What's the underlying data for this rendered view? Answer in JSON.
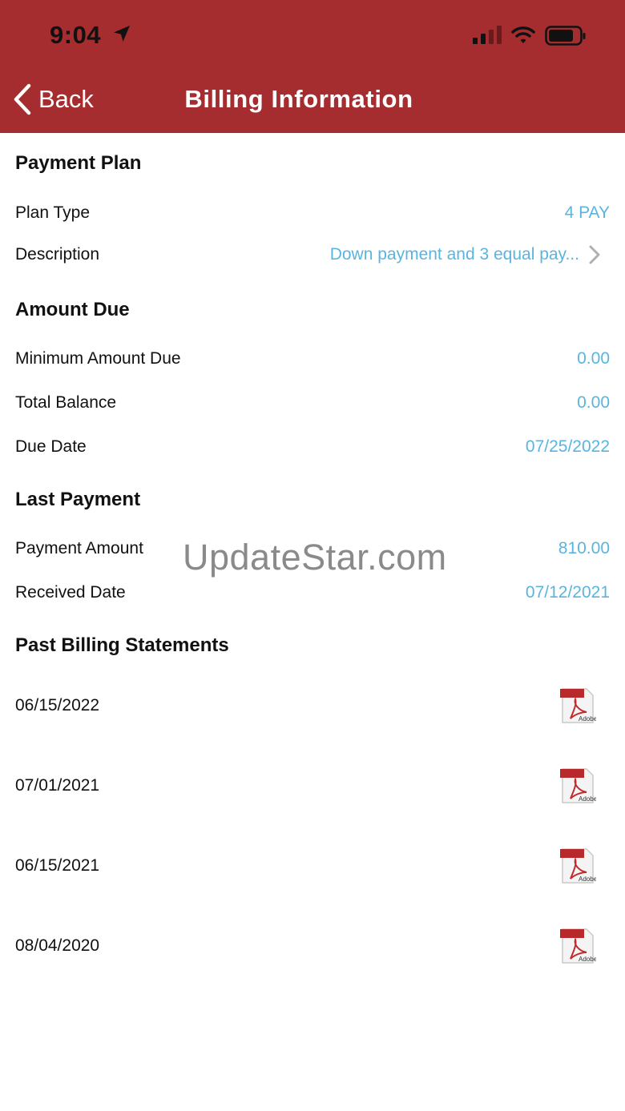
{
  "status_bar": {
    "time": "9:04"
  },
  "nav": {
    "back_label": "Back",
    "title": "Billing Information"
  },
  "payment_plan": {
    "heading": "Payment Plan",
    "rows": [
      {
        "label": "Plan Type",
        "value": "4 PAY"
      },
      {
        "label": "Description",
        "value": "Down payment and 3 equal pay..."
      }
    ]
  },
  "amount_due": {
    "heading": "Amount Due",
    "rows": [
      {
        "label": "Minimum Amount Due",
        "value": "0.00"
      },
      {
        "label": "Total Balance",
        "value": "0.00"
      },
      {
        "label": "Due Date",
        "value": "07/25/2022"
      }
    ]
  },
  "last_payment": {
    "heading": "Last Payment",
    "rows": [
      {
        "label": "Payment Amount",
        "value": "810.00"
      },
      {
        "label": "Received Date",
        "value": "07/12/2021"
      }
    ]
  },
  "statements": {
    "heading": "Past Billing Statements",
    "items": [
      {
        "date": "06/15/2022",
        "icon": "pdf-icon",
        "icon_text": "Adobe"
      },
      {
        "date": "07/01/2021",
        "icon": "pdf-icon",
        "icon_text": "Adobe"
      },
      {
        "date": "06/15/2021",
        "icon": "pdf-icon",
        "icon_text": "Adobe"
      },
      {
        "date": "08/04/2020",
        "icon": "pdf-icon",
        "icon_text": "Adobe"
      }
    ]
  },
  "watermark": "UpdateStar.com",
  "colors": {
    "header_bg": "#a52d2f",
    "value_blue": "#5ab4e0"
  }
}
